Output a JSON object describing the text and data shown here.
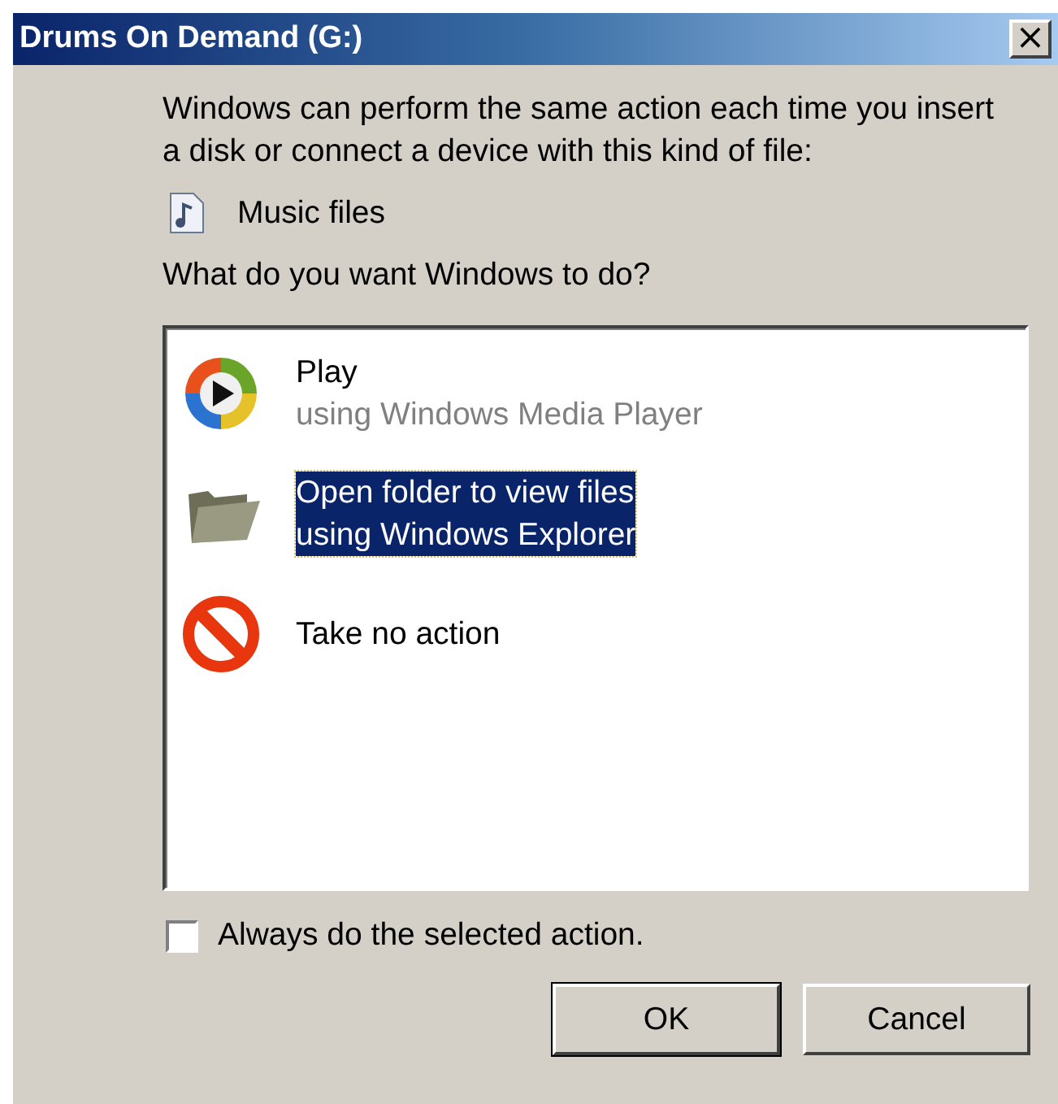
{
  "window": {
    "title": "Drums On Demand (G:)",
    "close": "×"
  },
  "intro": "Windows can perform the same action each time you insert a disk or connect a device with this kind of file:",
  "file_type": "Music files",
  "question": "What do you want Windows to do?",
  "actions": [
    {
      "kind": "media-player",
      "title": "Play",
      "subtitle": "using Windows Media Player",
      "selected": false
    },
    {
      "kind": "folder",
      "title": "Open folder to view files",
      "subtitle": "using Windows Explorer",
      "selected": true
    },
    {
      "kind": "no-action",
      "title": "Take no action",
      "selected": false
    }
  ],
  "always": {
    "label": "Always do the selected action.",
    "checked": false
  },
  "buttons": [
    {
      "label": "OK",
      "default": true
    },
    {
      "label": "Cancel",
      "default": false
    }
  ]
}
